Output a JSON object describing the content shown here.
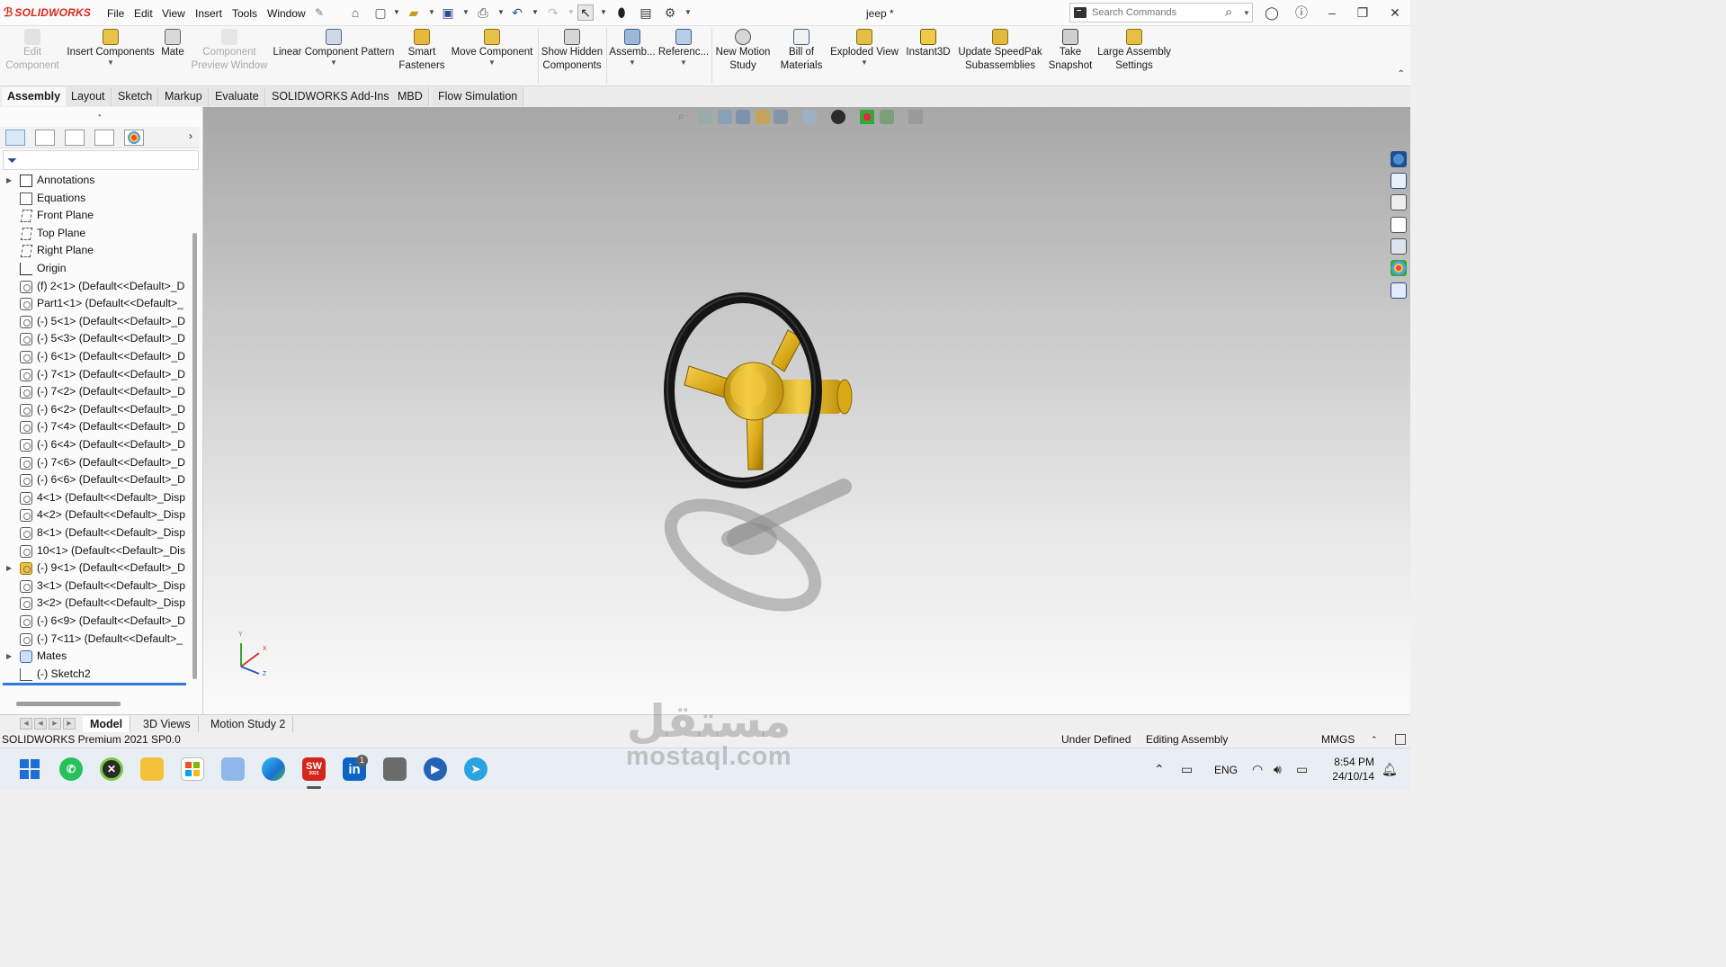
{
  "app": {
    "logo_text": "SOLIDWORKS",
    "document_title": "jeep *"
  },
  "menu": [
    "File",
    "Edit",
    "View",
    "Insert",
    "Tools",
    "Window"
  ],
  "search": {
    "placeholder": "Search Commands"
  },
  "ribbon": {
    "buttons": [
      {
        "label": "Edit Component",
        "disabled": true
      },
      {
        "label": "Insert Components",
        "disabled": false
      },
      {
        "label": "Mate",
        "disabled": false
      },
      {
        "label": "Component Preview Window",
        "disabled": true
      },
      {
        "label": "Linear Component Pattern",
        "disabled": false
      },
      {
        "label": "Smart Fasteners",
        "disabled": false
      },
      {
        "label": "Move Component",
        "disabled": false
      },
      {
        "label": "Show Hidden Components",
        "disabled": false
      },
      {
        "label": "Assemb...",
        "disabled": false
      },
      {
        "label": "Referenc...",
        "disabled": false
      },
      {
        "label": "New Motion Study",
        "disabled": false
      },
      {
        "label": "Bill of Materials",
        "disabled": false
      },
      {
        "label": "Exploded View",
        "disabled": false
      },
      {
        "label": "Instant3D",
        "disabled": false
      },
      {
        "label": "Update SpeedPak Subassemblies",
        "disabled": false
      },
      {
        "label": "Take Snapshot",
        "disabled": false
      },
      {
        "label": "Large Assembly Settings",
        "disabled": false
      }
    ]
  },
  "tabs": [
    "Assembly",
    "Layout",
    "Sketch",
    "Markup",
    "Evaluate",
    "SOLIDWORKS Add-Ins",
    "MBD",
    "Flow Simulation"
  ],
  "feature_tree": {
    "items": [
      {
        "label": "Annotations",
        "icon": "annotations-icon",
        "expandable": true
      },
      {
        "label": "Equations",
        "icon": "equations-icon",
        "expandable": false
      },
      {
        "label": "Front Plane",
        "icon": "plane-icon",
        "expandable": false
      },
      {
        "label": "Top Plane",
        "icon": "plane-icon",
        "expandable": false
      },
      {
        "label": "Right Plane",
        "icon": "plane-icon",
        "expandable": false
      },
      {
        "label": "Origin",
        "icon": "origin-icon",
        "expandable": false
      },
      {
        "label": "(f) 2<1> (Default<<Default>_D",
        "icon": "part-icon",
        "expandable": false
      },
      {
        "label": "Part1<1> (Default<<Default>_",
        "icon": "part-icon",
        "expandable": false
      },
      {
        "label": "(-) 5<1> (Default<<Default>_D",
        "icon": "part-icon",
        "expandable": false
      },
      {
        "label": "(-) 5<3> (Default<<Default>_D",
        "icon": "part-icon",
        "expandable": false
      },
      {
        "label": "(-) 6<1> (Default<<Default>_D",
        "icon": "part-icon",
        "expandable": false
      },
      {
        "label": "(-) 7<1> (Default<<Default>_D",
        "icon": "part-icon",
        "expandable": false
      },
      {
        "label": "(-) 7<2> (Default<<Default>_D",
        "icon": "part-icon",
        "expandable": false
      },
      {
        "label": "(-) 6<2> (Default<<Default>_D",
        "icon": "part-icon",
        "expandable": false
      },
      {
        "label": "(-) 7<4> (Default<<Default>_D",
        "icon": "part-icon",
        "expandable": false
      },
      {
        "label": "(-) 6<4> (Default<<Default>_D",
        "icon": "part-icon",
        "expandable": false
      },
      {
        "label": "(-) 7<6> (Default<<Default>_D",
        "icon": "part-icon",
        "expandable": false
      },
      {
        "label": "(-) 6<6> (Default<<Default>_D",
        "icon": "part-icon",
        "expandable": false
      },
      {
        "label": "4<1> (Default<<Default>_Disp",
        "icon": "part-icon",
        "expandable": false
      },
      {
        "label": "4<2> (Default<<Default>_Disp",
        "icon": "part-icon",
        "expandable": false
      },
      {
        "label": "8<1> (Default<<Default>_Disp",
        "icon": "part-icon",
        "expandable": false
      },
      {
        "label": "10<1> (Default<<Default>_Dis",
        "icon": "part-icon",
        "expandable": false
      },
      {
        "label": "(-) 9<1> (Default<<Default>_D",
        "icon": "subassembly-icon",
        "expandable": true
      },
      {
        "label": "3<1> (Default<<Default>_Disp",
        "icon": "part-icon",
        "expandable": false
      },
      {
        "label": "3<2> (Default<<Default>_Disp",
        "icon": "part-icon",
        "expandable": false
      },
      {
        "label": "(-) 6<9> (Default<<Default>_D",
        "icon": "part-icon",
        "expandable": false
      },
      {
        "label": "(-) 7<11> (Default<<Default>_",
        "icon": "part-icon",
        "expandable": false
      },
      {
        "label": "Mates",
        "icon": "mates-icon",
        "expandable": true
      },
      {
        "label": "(-) Sketch2",
        "icon": "sketch-icon",
        "expandable": false
      }
    ]
  },
  "triad": {
    "x": "X",
    "y": "Y",
    "z": "Z"
  },
  "bottom_tabs": [
    "Model",
    "3D Views",
    "Motion Study 2"
  ],
  "status": {
    "product": "SOLIDWORKS Premium 2021 SP0.0",
    "state": "Under Defined",
    "mode": "Editing Assembly",
    "units": "MMGS"
  },
  "taskbar": {
    "apps": [
      "windows-start",
      "whatsapp",
      "xbox",
      "file-explorer",
      "microsoft-store",
      "photos",
      "edge",
      "solidworks",
      "linkedin",
      "app-window",
      "app-blue",
      "telegram"
    ],
    "solidworks_badge": "SW",
    "solidworks_year": "2021",
    "linkedin_badge": "in",
    "notification_count": "1",
    "language": "ENG",
    "time": "8:54 PM",
    "date": "24/10/14"
  },
  "watermark": {
    "arabic": "مستقل",
    "latin": "mostaql.com"
  },
  "colors": {
    "brand_red": "#d9261c",
    "accent_blue": "#2e7cd6",
    "wheel_gold": "#e1b21a",
    "wheel_rim": "#1e1e1e"
  }
}
